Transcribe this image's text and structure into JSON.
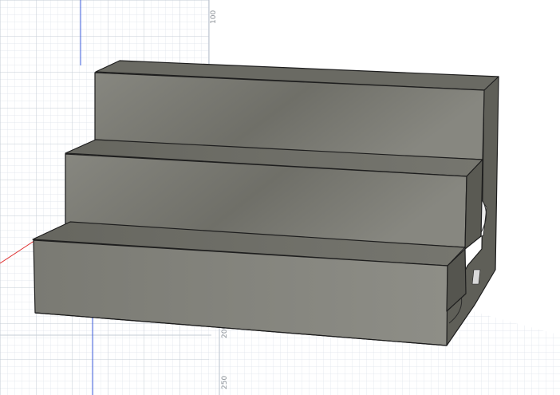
{
  "viewport": {
    "ruler_labels": [
      "100",
      "200",
      "250"
    ]
  },
  "colors": {
    "background": "#ffffff",
    "grid_minor": "#dde3ea",
    "grid_major": "#c5ccd6",
    "axis_blue": "#3b5bdb",
    "axis_red": "#e03131",
    "body_light": "#8c8c85",
    "body_mid": "#727269",
    "body_dark": "#5c5c55",
    "edge": "#1e1e1e"
  }
}
